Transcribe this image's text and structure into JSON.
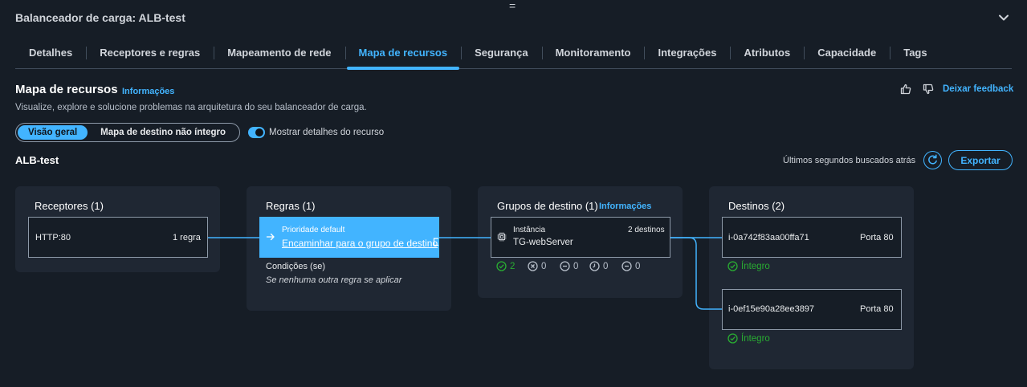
{
  "header": {
    "title": "Balanceador de carga: ALB-test",
    "drag_glyph": "="
  },
  "tabs": [
    {
      "label": "Detalhes"
    },
    {
      "label": "Receptores e regras"
    },
    {
      "label": "Mapeamento de rede"
    },
    {
      "label": "Mapa de recursos",
      "active": true
    },
    {
      "label": "Segurança"
    },
    {
      "label": "Monitoramento"
    },
    {
      "label": "Integrações"
    },
    {
      "label": "Atributos"
    },
    {
      "label": "Capacidade"
    },
    {
      "label": "Tags"
    }
  ],
  "resource_map": {
    "title": "Mapa de recursos",
    "info_link": "Informações",
    "description": "Visualize, explore e solucione problemas na arquitetura do seu balanceador de carga.",
    "feedback_label": "Deixar feedback",
    "view_overview": "Visão geral",
    "view_unhealthy": "Mapa de destino não íntegro",
    "show_details_label": "Mostrar detalhes do recurso",
    "show_details_on": true
  },
  "lb": {
    "name": "ALB-test",
    "last_fetched": "Últimos segundos buscados atrás",
    "export_label": "Exportar"
  },
  "listeners": {
    "title": "Receptores (1)",
    "item": {
      "name": "HTTP:80",
      "rules": "1 regra"
    }
  },
  "rules": {
    "title": "Regras (1)",
    "item": {
      "priority": "Prioridade default",
      "action": "Encaminhar para o grupo de destino"
    },
    "conditions_label": "Condições (se)",
    "conditions_value": "Se nenhuma outra regra se aplicar"
  },
  "target_groups": {
    "title": "Grupos de destino (1)",
    "info_link": "Informações",
    "item": {
      "type": "Instância",
      "name": "TG-webServer",
      "count": "2 destinos"
    },
    "metrics": {
      "healthy": "2",
      "unhealthy": "0",
      "unused": "0",
      "draining": "0",
      "unavailable": "0"
    }
  },
  "targets": {
    "title": "Destinos (2)",
    "items": [
      {
        "id": "i-0a742f83aa00ffa71",
        "port": "Porta 80",
        "status": "Íntegro"
      },
      {
        "id": "i-0ef15e90a28ee3897",
        "port": "Porta 80",
        "status": "Íntegro"
      }
    ]
  },
  "colors": {
    "accent": "#42b4ff",
    "background": "#161d26",
    "panel": "#1f2733",
    "healthy": "#29ad32"
  }
}
